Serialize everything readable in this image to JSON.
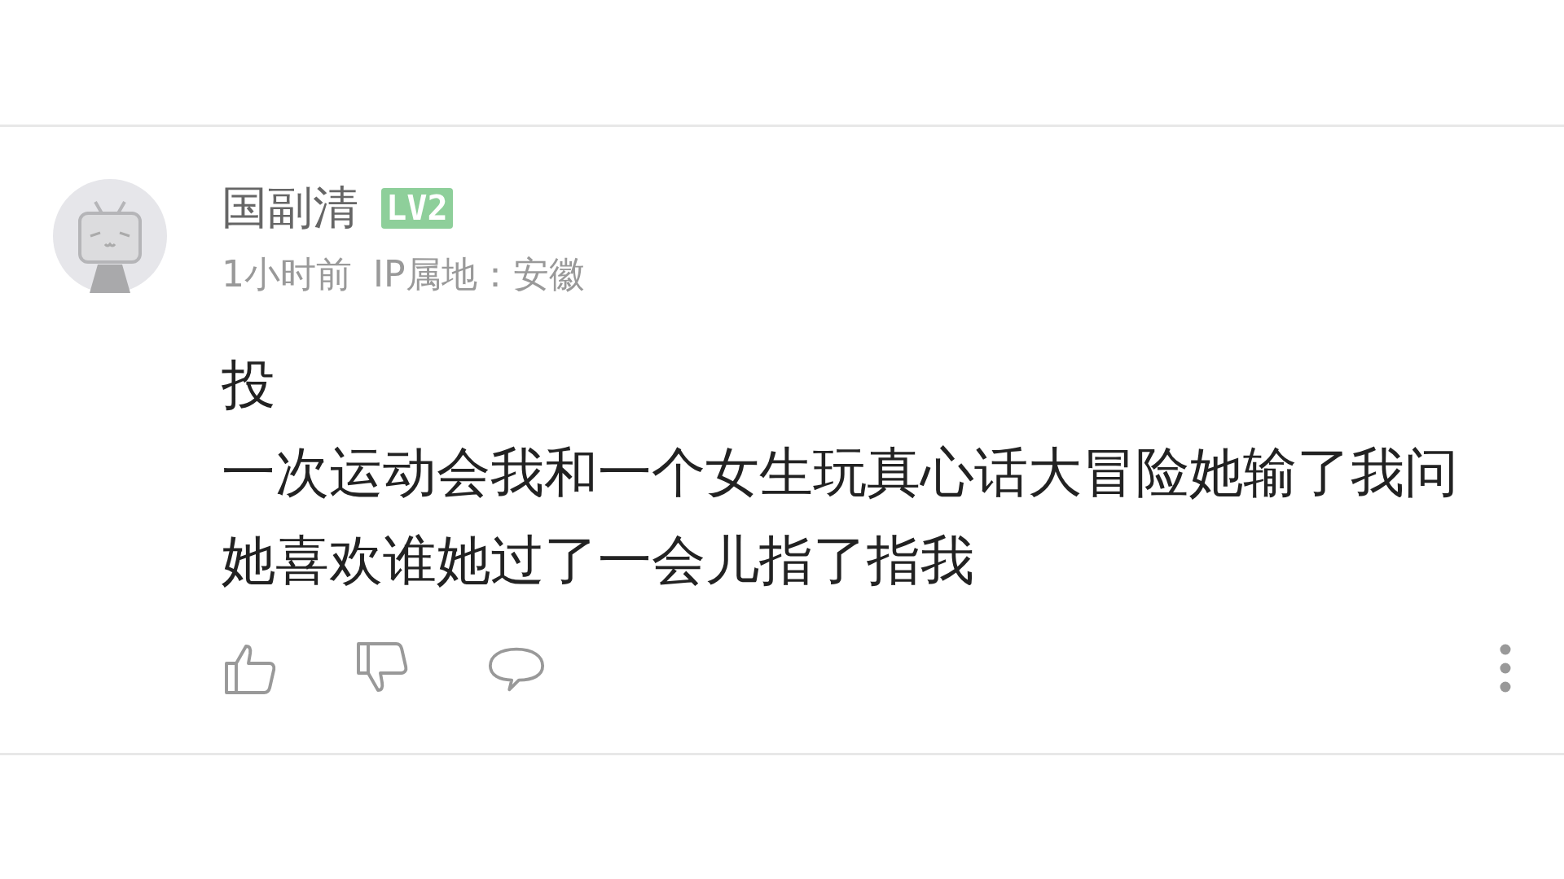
{
  "comment": {
    "username": "国副清",
    "level_badge": "LV2",
    "time": "1小时前",
    "ip_location": "IP属地：安徽",
    "paragraphs": [
      "投",
      "一次运动会我和一个女生玩真心话大冒险她输了我问她喜欢谁她过了一会儿指了指我"
    ]
  }
}
